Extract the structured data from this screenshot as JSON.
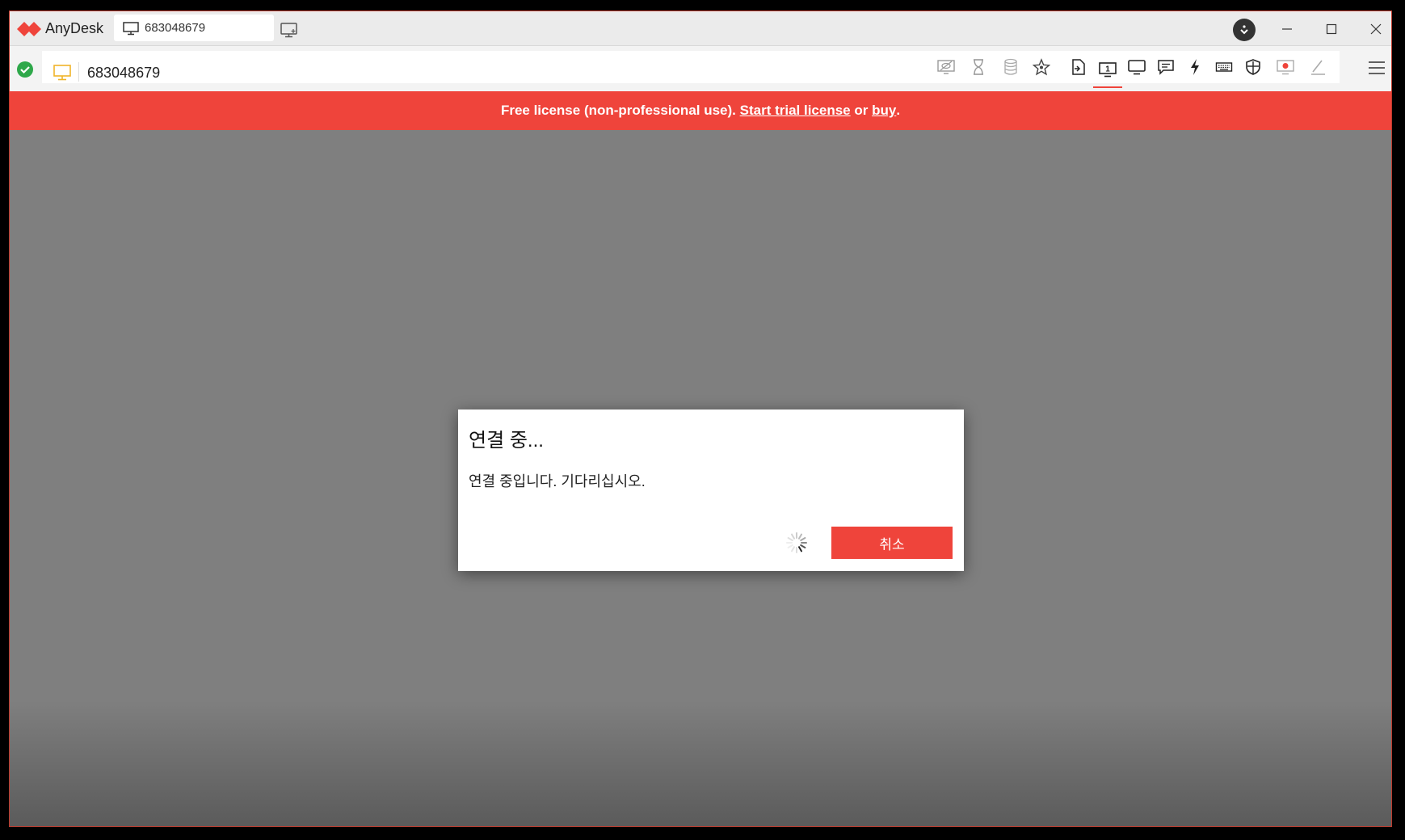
{
  "app": {
    "name": "AnyDesk",
    "brand_color": "#ef443b"
  },
  "tab": {
    "label": "683048679",
    "icon": "monitor-icon"
  },
  "titlebar": {
    "buttons": [
      "minimize-icon",
      "maximize-icon",
      "close-icon"
    ]
  },
  "toolbar": {
    "address": "683048679",
    "status": "connected-check-icon",
    "actions": [
      "privacy-mode-icon",
      "timer-icon",
      "database-icon",
      "favorite-star-icon",
      "file-transfer-icon",
      "display-1-icon",
      "display-icon",
      "chat-icon",
      "actions-lightning-icon",
      "keyboard-icon",
      "permissions-shield-icon",
      "record-icon",
      "whiteboard-pen-icon"
    ],
    "active_action": "display-1-icon"
  },
  "banner": {
    "text_before": "Free license (non-professional use). ",
    "link_trial": "Start trial license",
    "text_or": " or ",
    "link_buy": "buy",
    "text_end": "."
  },
  "dialog": {
    "title": "연결 중...",
    "message": "연결 중입니다. 기다리십시오.",
    "cancel_label": "취소"
  }
}
